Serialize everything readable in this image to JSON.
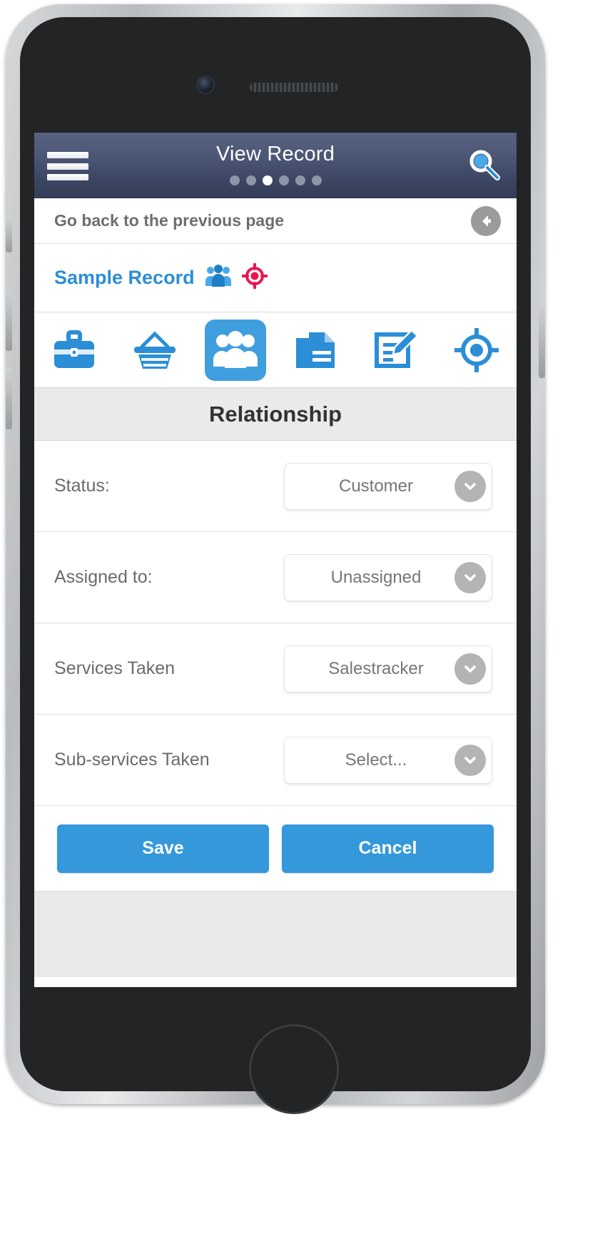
{
  "header": {
    "title": "View Record",
    "menu_icon": "hamburger-menu-icon",
    "search_icon": "search-magnifier-icon",
    "pager": {
      "total": 6,
      "active_index": 2
    }
  },
  "goback": {
    "text": "Go back to the previous page",
    "icon": "back-arrow-icon"
  },
  "record": {
    "title": "Sample Record",
    "badge_people_icon": "people-group-icon",
    "badge_target_icon": "target-icon",
    "badge_target_color": "#e8174f",
    "title_color": "#2b8ed6"
  },
  "icon_nav": {
    "active_index": 2,
    "active_color": "#3f9ede",
    "items": [
      {
        "name": "briefcase-icon",
        "label": "Opportunities"
      },
      {
        "name": "basket-icon",
        "label": "Products"
      },
      {
        "name": "people-icon",
        "label": "Relationship"
      },
      {
        "name": "documents-icon",
        "label": "Documents"
      },
      {
        "name": "notes-edit-icon",
        "label": "Notes"
      },
      {
        "name": "target-icon",
        "label": "Targets"
      }
    ]
  },
  "section": {
    "title": "Relationship"
  },
  "form": {
    "rows": [
      {
        "label": "Status:",
        "value": "Customer"
      },
      {
        "label": "Assigned to:",
        "value": "Unassigned"
      },
      {
        "label": "Services Taken",
        "value": "Salestracker"
      },
      {
        "label": "Sub-services Taken",
        "value": "Select..."
      }
    ]
  },
  "actions": {
    "save_label": "Save",
    "cancel_label": "Cancel",
    "button_color": "#3498db"
  }
}
